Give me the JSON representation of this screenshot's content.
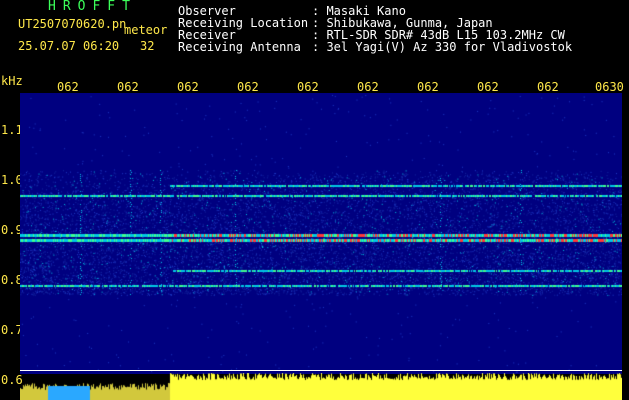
{
  "header": {
    "logo": "HROFFT",
    "filename": "UT2507070620.pn",
    "mode": "meteor",
    "datetime": "25.07.07 06:20",
    "count": "32"
  },
  "meta": [
    {
      "label": "Observer",
      "value": ": Masaki Kano"
    },
    {
      "label": "Receiving Location",
      "value": ": Shibukawa, Gunma, Japan"
    },
    {
      "label": "Receiver",
      "value": ": RTL-SDR SDR# 43dB L15 103.2MHz CW"
    },
    {
      "label": "Receiving Antenna",
      "value": ": 3el Yagi(V) Az 330 for Vladivostok"
    }
  ],
  "chart_data": {
    "type": "heatmap",
    "ylabel": "kHz",
    "yticks": [
      "1.1",
      "1.0",
      "0.9",
      "0.8",
      "0.7",
      "0.6"
    ],
    "xticks": [
      "062",
      "062",
      "062",
      "062",
      "062",
      "062",
      "062",
      "062",
      "062",
      "0630"
    ],
    "ylim": [
      0.6,
      1.1
    ],
    "signal_lines_khz": [
      0.99,
      0.97,
      0.89,
      0.88,
      0.82,
      0.79
    ],
    "colors": {
      "background": "#000080",
      "weak": "#1e3cc8",
      "mid": "#00c8e6",
      "strong": "#ff3a3a"
    }
  }
}
